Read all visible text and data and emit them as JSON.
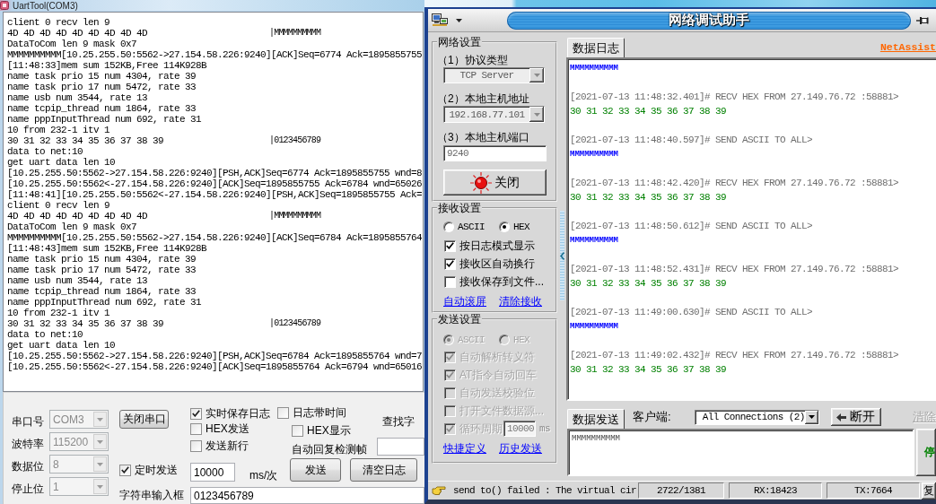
{
  "uart_window": {
    "title": "UartTool(COM3)",
    "terminal_lines": [
      {
        "kind": "text",
        "text": "client 0 recv len 9"
      },
      {
        "kind": "dump",
        "hex": "4D 4D 4D 4D 4D 4D 4D 4D 4D",
        "ascii": "|MMMMMMMMMM"
      },
      {
        "kind": "text",
        "text": "DataToCom len 9 mask 0x7"
      },
      {
        "kind": "text",
        "text": "MMMMMMMMMM[10.25.255.50:5562->27.154.58.226:9240][ACK]Seq=6774 Ack=1895855755"
      },
      {
        "kind": "text",
        "text": "[11:48:33]mem sum 152KB,Free 114K928B"
      },
      {
        "kind": "text",
        "text": "name task prio 15 num 4304, rate 39"
      },
      {
        "kind": "text",
        "text": "name task prio 17 num 5472, rate 33"
      },
      {
        "kind": "text",
        "text": "name usb num 3544, rate 13"
      },
      {
        "kind": "text",
        "text": "name tcpip_thread num 1864, rate 33"
      },
      {
        "kind": "text",
        "text": "name pppInputThread num 692, rate 31"
      },
      {
        "kind": "text",
        "text": "10 from 232-1 itv 1"
      },
      {
        "kind": "dump",
        "hex": "30 31 32 33 34 35 36 37 38 39",
        "ascii": "|0123456789"
      },
      {
        "kind": "text",
        "text": "data to net:10"
      },
      {
        "kind": "text",
        "text": "get uart data len 10"
      },
      {
        "kind": "text",
        "text": "[10.25.255.50:5562->27.154.58.226:9240][PSH,ACK]Seq=6774 Ack=1895855755 wnd=8"
      },
      {
        "kind": "text",
        "text": "[10.25.255.50:5562<-27.154.58.226:9240][ACK]Seq=1895855755 Ack=6784 wnd=65026"
      },
      {
        "kind": "text",
        "text": "[11:48:41][10.25.255.50:5562<-27.154.58.226:9240][PSH,ACK]Seq=1895855755 Ack="
      },
      {
        "kind": "text",
        "text": "client 0 recv len 9"
      },
      {
        "kind": "dump",
        "hex": "4D 4D 4D 4D 4D 4D 4D 4D 4D",
        "ascii": "|MMMMMMMMMM"
      },
      {
        "kind": "text",
        "text": "DataToCom len 9 mask 0x7"
      },
      {
        "kind": "text",
        "text": "MMMMMMMMMM[10.25.255.50:5562->27.154.58.226:9240][ACK]Seq=6784 Ack=1895855764"
      },
      {
        "kind": "text",
        "text": "[11:48:43]mem sum 152KB,Free 114K928B"
      },
      {
        "kind": "text",
        "text": "name task prio 15 num 4304, rate 39"
      },
      {
        "kind": "text",
        "text": "name task prio 17 num 5472, rate 33"
      },
      {
        "kind": "text",
        "text": "name usb num 3544, rate 13"
      },
      {
        "kind": "text",
        "text": "name tcpip_thread num 1864, rate 33"
      },
      {
        "kind": "text",
        "text": "name pppInputThread num 692, rate 31"
      },
      {
        "kind": "text",
        "text": "10 from 232-1 itv 1"
      },
      {
        "kind": "dump",
        "hex": "30 31 32 33 34 35 36 37 38 39",
        "ascii": "|0123456789"
      },
      {
        "kind": "text",
        "text": "data to net:10"
      },
      {
        "kind": "text",
        "text": "get uart data len 10"
      },
      {
        "kind": "text",
        "text": "[10.25.255.50:5562->27.154.58.226:9240][PSH,ACK]Seq=6784 Ack=1895855764 wnd=7"
      },
      {
        "kind": "text",
        "text": "[10.25.255.50:5562<-27.154.58.226:9240][ACK]Seq=1895855764 Ack=6794 wnd=65016"
      }
    ],
    "port_settings": [
      {
        "label": "串口号",
        "value": "COM3",
        "disabled": true
      },
      {
        "label": "波特率",
        "value": "115200",
        "disabled": true
      },
      {
        "label": "数据位",
        "value": "8",
        "disabled": true
      },
      {
        "label": "停止位",
        "value": "1",
        "disabled": true
      }
    ],
    "close_port_button": "关闭串口",
    "options": [
      {
        "label": "实时保存日志",
        "checked": true
      },
      {
        "label": "日志带时间",
        "checked": false
      },
      {
        "label": "HEX发送",
        "checked": false
      },
      {
        "label": "HEX显示",
        "checked": false
      },
      {
        "label": "发送新行",
        "checked": false
      }
    ],
    "auto_reply_label": "自动回复检测帧",
    "find_label": "查找字",
    "timed_send": {
      "label": "定时发送",
      "checked": true,
      "interval": "10000",
      "unit": "ms/次"
    },
    "send_button": "发送",
    "clear_log_button": "清空日志",
    "string_input": {
      "label": "字符串输入框",
      "value": "0123456789"
    }
  },
  "net_window": {
    "title": "网络调试助手",
    "network_settings": {
      "title": "网络设置",
      "fields": [
        {
          "label": "（1）协议类型",
          "kind": "select",
          "value": "TCP Server",
          "disabled": true
        },
        {
          "label": "（2）本地主机地址",
          "kind": "select",
          "value": "192.168.77.101",
          "disabled": true
        },
        {
          "label": "（3）本地主机端口",
          "kind": "input",
          "value": "9240",
          "disabled": true
        }
      ],
      "toggle_button": "关闭"
    },
    "receive_settings": {
      "title": "接收设置",
      "disabled": false,
      "modes": [
        {
          "label": "ASCII",
          "selected": false
        },
        {
          "label": "HEX",
          "selected": true
        }
      ],
      "options": [
        {
          "kind": "checkbox",
          "label": "按日志模式显示",
          "checked": true
        },
        {
          "kind": "checkbox",
          "label": "接收区自动换行",
          "checked": true
        },
        {
          "kind": "checkbox",
          "label": "接收保存到文件...",
          "checked": false
        }
      ],
      "links": [
        "自动滚屏",
        "清除接收"
      ]
    },
    "send_settings": {
      "title": "发送设置",
      "disabled": true,
      "modes": [
        {
          "label": "ASCII",
          "selected": true
        },
        {
          "label": "HEX",
          "selected": false
        }
      ],
      "options": [
        {
          "kind": "checkbox",
          "label": "自动解析转义符",
          "checked": true
        },
        {
          "kind": "checkbox",
          "label": "AT指令自动回车",
          "checked": true
        },
        {
          "kind": "checkbox",
          "label": "自动发送校验位",
          "checked": false
        },
        {
          "kind": "checkbox",
          "label": "打开文件数据源...",
          "checked": false
        },
        {
          "kind": "interval",
          "label": "循环周期",
          "checked": true,
          "value": "10000",
          "unit": "ms"
        }
      ],
      "links": [
        "快捷定义",
        "历史发送"
      ]
    },
    "log_tab": {
      "label": "数据日志",
      "selected": true
    },
    "brand_link": "NetAssist",
    "log_entries": [
      {
        "kind": "send",
        "data": "MMMMMMMMMM"
      },
      {
        "kind": "recv",
        "header": "[2021-07-13 11:48:32.401]# RECV HEX FROM 27.149.76.72 :58881>",
        "data": "30 31 32 33 34 35 36 37 38 39"
      },
      {
        "kind": "send",
        "header": "[2021-07-13 11:48:40.597]# SEND ASCII TO ALL>",
        "data": "MMMMMMMMMM"
      },
      {
        "kind": "recv",
        "header": "[2021-07-13 11:48:42.420]# RECV HEX FROM 27.149.76.72 :58881>",
        "data": "30 31 32 33 34 35 36 37 38 39"
      },
      {
        "kind": "send",
        "header": "[2021-07-13 11:48:50.612]# SEND ASCII TO ALL>",
        "data": "MMMMMMMMMM"
      },
      {
        "kind": "recv",
        "header": "[2021-07-13 11:48:52.431]# RECV HEX FROM 27.149.76.72 :58881>",
        "data": "30 31 32 33 34 35 36 37 38 39"
      },
      {
        "kind": "send",
        "header": "[2021-07-13 11:49:00.630]# SEND ASCII TO ALL>",
        "data": "MMMMMMMMMM"
      },
      {
        "kind": "recv",
        "header": "[2021-07-13 11:49:02.432]# RECV HEX FROM 27.149.76.72 :58881>",
        "data": "30 31 32 33 34 35 36 37 38 39"
      }
    ],
    "send_tab": {
      "label": "数据发送",
      "selected": true
    },
    "client_label": "客户端:",
    "client_select": "All Connections (2)",
    "disconnect_button": "断开",
    "clear_button": {
      "label": "清除",
      "disabled": true
    },
    "send_text": "MMMMMMMMMM",
    "stop_button": "停",
    "status_bar": {
      "message": "send to() failed : The virtual cir",
      "cells": [
        "2722/1381",
        "RX:18423",
        "TX:7664"
      ],
      "reset_button": "复"
    }
  }
}
